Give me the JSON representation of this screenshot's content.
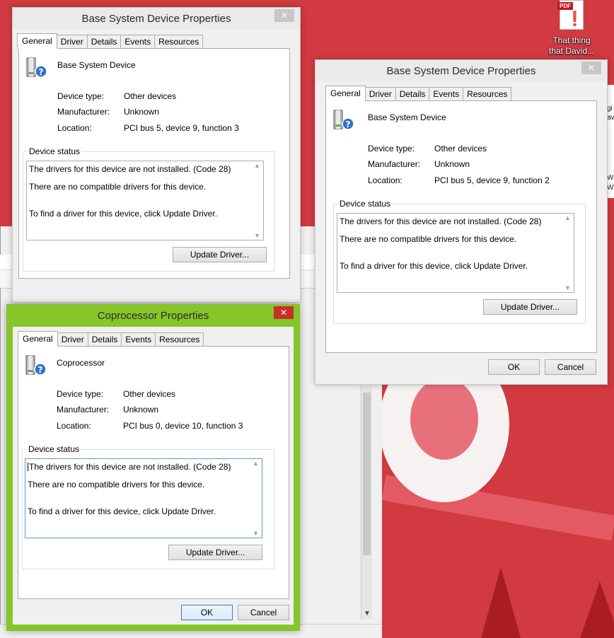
{
  "desktop": {
    "pdf_icon": {
      "badge": "PDF",
      "label_line1": "That thing",
      "label_line2": "that David..."
    },
    "right_edge_text": [
      "gi",
      "av",
      "W",
      "W"
    ],
    "colors": {
      "wallpaper": "#d13a40",
      "active_title": "#86c629",
      "close_active": "#c7302b"
    }
  },
  "icons": {
    "device": "unknown-device-icon",
    "close": "close-icon",
    "scroll_up": "scroll-up-arrow-icon",
    "scroll_down": "scroll-down-arrow-icon",
    "pdf": "pdf-file-icon"
  },
  "tabs": [
    "General",
    "Driver",
    "Details",
    "Events",
    "Resources"
  ],
  "labels": {
    "device_type": "Device type:",
    "manufacturer": "Manufacturer:",
    "location": "Location:",
    "device_status": "Device status",
    "update_driver": "Update Driver...",
    "ok": "OK",
    "cancel": "Cancel",
    "close_glyph": "✕"
  },
  "dialogs": [
    {
      "title": "Base System Device Properties",
      "state": "inactive",
      "device_name": "Base System Device",
      "device_type": "Other devices",
      "manufacturer": "Unknown",
      "location": "PCI bus 5, device 9, function 3",
      "status_lines": [
        "The drivers for this device are not installed. (Code 28)",
        "There are no compatible drivers for this device.",
        "To find a driver for this device, click Update Driver."
      ]
    },
    {
      "title": "Base System Device Properties",
      "state": "inactive",
      "device_name": "Base System Device",
      "device_type": "Other devices",
      "manufacturer": "Unknown",
      "location": "PCI bus 5, device 9, function 2",
      "status_lines": [
        "The drivers for this device are not installed. (Code 28)",
        "There are no compatible drivers for this device.",
        "To find a driver for this device, click Update Driver."
      ]
    },
    {
      "title": "Coprocessor Properties",
      "state": "active",
      "device_name": "Coprocessor",
      "device_type": "Other devices",
      "manufacturer": "Unknown",
      "location": "PCI bus 0, device 10, function 3",
      "status_lines": [
        "The drivers for this device are not installed. (Code 28)",
        "There are no compatible drivers for this device.",
        "To find a driver for this device, click Update Driver."
      ]
    }
  ]
}
